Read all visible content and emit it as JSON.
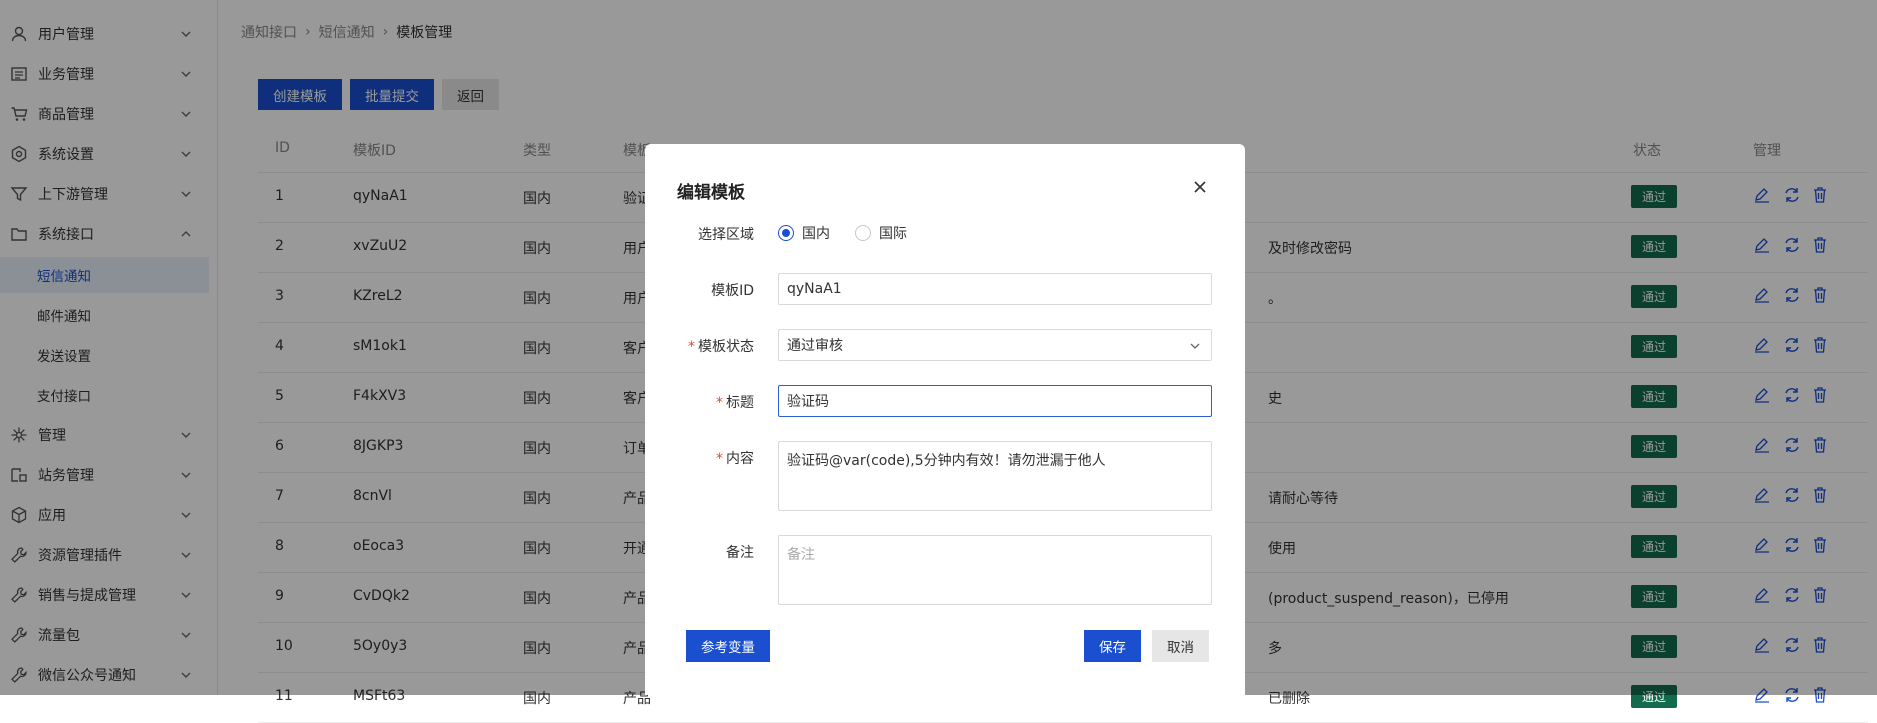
{
  "sidebar": {
    "items": [
      {
        "label": "用户管理",
        "icon": "user-icon"
      },
      {
        "label": "业务管理",
        "icon": "document-icon"
      },
      {
        "label": "商品管理",
        "icon": "cart-icon"
      },
      {
        "label": "系统设置",
        "icon": "gear-icon"
      },
      {
        "label": "上下游管理",
        "icon": "filter-icon"
      },
      {
        "label": "系统接口",
        "icon": "folder-icon"
      },
      {
        "label": "管理",
        "icon": "sparkle-icon"
      },
      {
        "label": "站务管理",
        "icon": "site-icon"
      },
      {
        "label": "应用",
        "icon": "cube-icon"
      },
      {
        "label": "资源管理插件",
        "icon": "wrench-icon"
      },
      {
        "label": "销售与提成管理",
        "icon": "wrench-icon"
      },
      {
        "label": "流量包",
        "icon": "wrench-icon"
      },
      {
        "label": "微信公众号通知",
        "icon": "wrench-icon"
      }
    ],
    "sub_items": [
      "短信通知",
      "邮件通知",
      "发送设置",
      "支付接口"
    ],
    "active_sub": "短信通知"
  },
  "breadcrumb": [
    "通知接口",
    "短信通知",
    "模板管理"
  ],
  "toolbar": {
    "create": "创建模板",
    "batch": "批量提交",
    "back": "返回"
  },
  "table": {
    "headers": [
      "ID",
      "模板ID",
      "类型",
      "模板",
      "状态",
      "管理"
    ],
    "rows": [
      {
        "id": "1",
        "tid": "qyNaA1",
        "type": "国内",
        "tpl_prefix": "验证",
        "content_tail": "",
        "status": "通过"
      },
      {
        "id": "2",
        "tid": "xvZuU2",
        "type": "国内",
        "tpl_prefix": "用户",
        "content_tail": "及时修改密码",
        "status": "通过"
      },
      {
        "id": "3",
        "tid": "KZreL2",
        "type": "国内",
        "tpl_prefix": "用户",
        "content_tail": "。",
        "status": "通过"
      },
      {
        "id": "4",
        "tid": "sM1ok1",
        "type": "国内",
        "tpl_prefix": "客户",
        "content_tail": "",
        "status": "通过"
      },
      {
        "id": "5",
        "tid": "F4kXV3",
        "type": "国内",
        "tpl_prefix": "客户",
        "content_tail": "史",
        "status": "通过"
      },
      {
        "id": "6",
        "tid": "8JGKP3",
        "type": "国内",
        "tpl_prefix": "订单",
        "content_tail": "",
        "status": "通过"
      },
      {
        "id": "7",
        "tid": "8cnVl",
        "type": "国内",
        "tpl_prefix": "产品",
        "content_tail": "请耐心等待",
        "status": "通过"
      },
      {
        "id": "8",
        "tid": "oEoca3",
        "type": "国内",
        "tpl_prefix": "开通",
        "content_tail": "使用",
        "status": "通过"
      },
      {
        "id": "9",
        "tid": "CvDQk2",
        "type": "国内",
        "tpl_prefix": "产品",
        "content_tail": "(product_suspend_reason)，已停用",
        "status": "通过"
      },
      {
        "id": "10",
        "tid": "5Oy0y3",
        "type": "国内",
        "tpl_prefix": "产品",
        "content_tail": "多",
        "status": "通过"
      },
      {
        "id": "11",
        "tid": "MSFt63",
        "type": "国内",
        "tpl_prefix": "产品",
        "content_tail": "已删除",
        "status": "通过"
      }
    ]
  },
  "modal": {
    "title": "编辑模板",
    "region_label": "选择区域",
    "region_options": [
      "国内",
      "国际"
    ],
    "region_selected": "国内",
    "tid_label": "模板ID",
    "tid_value": "qyNaA1",
    "status_label": "模板状态",
    "status_value": "通过审核",
    "title_label": "标题",
    "title_value": "验证码",
    "content_label": "内容",
    "content_value": "验证码@var(code),5分钟内有效！请勿泄漏于他人",
    "note_label": "备注",
    "note_placeholder": "备注",
    "ref_button": "参考变量",
    "save_button": "保存",
    "cancel_button": "取消"
  },
  "colors": {
    "primary": "#1a4fd0",
    "badge": "#136b4e",
    "required": "#e34b2a"
  }
}
